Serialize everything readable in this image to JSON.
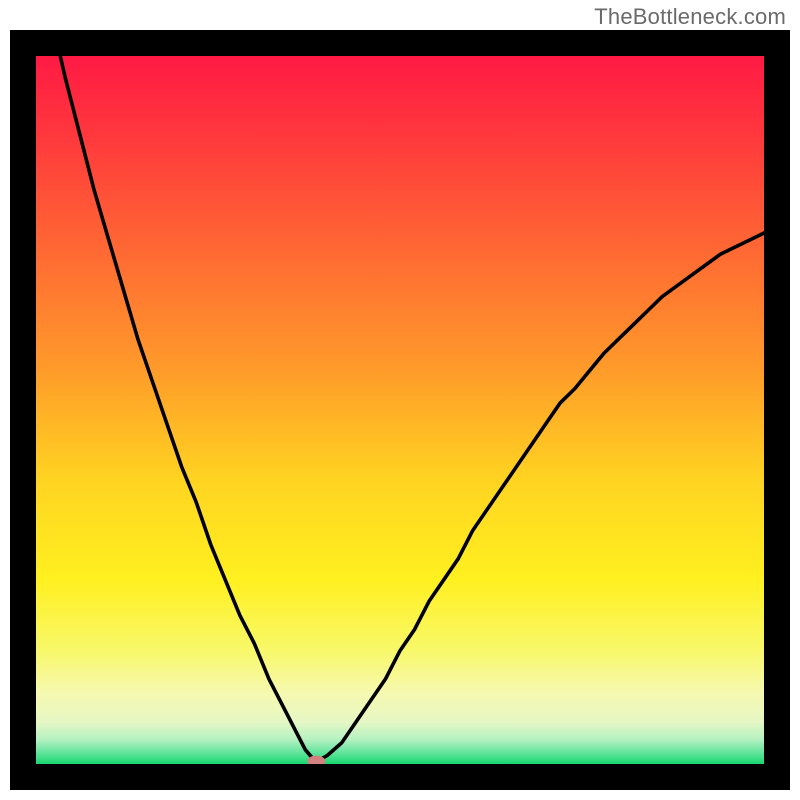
{
  "watermark": "TheBottleneck.com",
  "chart_data": {
    "type": "line",
    "title": "",
    "xlabel": "",
    "ylabel": "",
    "xlim": [
      0,
      100
    ],
    "ylim": [
      0,
      100
    ],
    "series": [
      {
        "name": "curve",
        "x": [
          0,
          2,
          4,
          6,
          8,
          10,
          12,
          14,
          16,
          18,
          20,
          22,
          24,
          26,
          28,
          30,
          32,
          34,
          36,
          37,
          38,
          39,
          40,
          42,
          44,
          46,
          48,
          50,
          52,
          54,
          56,
          58,
          60,
          62,
          64,
          66,
          68,
          70,
          72,
          74,
          76,
          78,
          80,
          82,
          84,
          86,
          88,
          90,
          92,
          94,
          96,
          98,
          100
        ],
        "y": [
          115,
          106,
          97,
          89,
          81,
          74,
          67,
          60,
          54,
          48,
          42,
          37,
          31,
          26,
          21,
          17,
          12,
          8,
          4,
          2,
          0.8,
          0.6,
          1.2,
          3,
          6,
          9,
          12,
          16,
          19,
          23,
          26,
          29,
          33,
          36,
          39,
          42,
          45,
          48,
          51,
          53,
          55.5,
          58,
          60,
          62,
          64,
          66,
          67.5,
          69,
          70.5,
          72,
          73,
          74,
          75
        ]
      }
    ],
    "marker": {
      "x": 38.5,
      "y": 0.4,
      "color": "#d38080"
    },
    "gradient_stops": [
      {
        "offset": 0.0,
        "color": "#ff1a44"
      },
      {
        "offset": 0.12,
        "color": "#ff3a3c"
      },
      {
        "offset": 0.28,
        "color": "#ff6a33"
      },
      {
        "offset": 0.44,
        "color": "#ff9a2a"
      },
      {
        "offset": 0.6,
        "color": "#ffd421"
      },
      {
        "offset": 0.74,
        "color": "#fff020"
      },
      {
        "offset": 0.84,
        "color": "#f8f86a"
      },
      {
        "offset": 0.9,
        "color": "#f6f9b0"
      },
      {
        "offset": 0.94,
        "color": "#e6f7c4"
      },
      {
        "offset": 0.965,
        "color": "#b6f2c2"
      },
      {
        "offset": 0.985,
        "color": "#5de39a"
      },
      {
        "offset": 1.0,
        "color": "#18d66e"
      }
    ],
    "frame_color": "#000000",
    "curve_color": "#000000"
  }
}
